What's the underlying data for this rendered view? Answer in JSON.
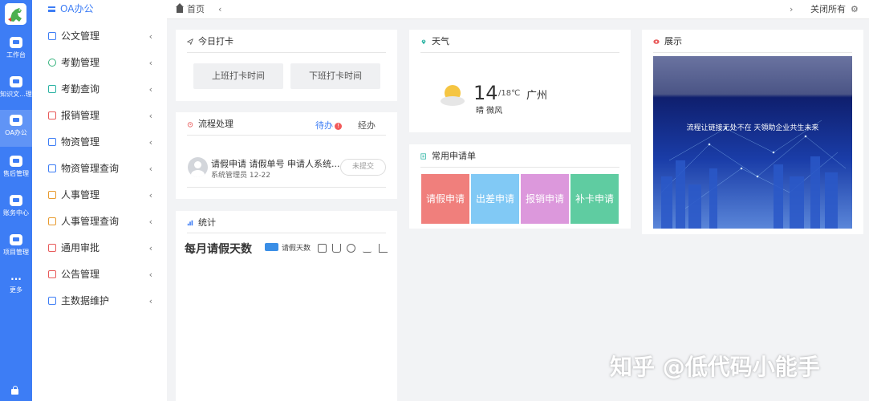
{
  "rail": {
    "items": [
      {
        "label": "工作台",
        "icon": "workbench-icon"
      },
      {
        "label": "知识文...理",
        "icon": "knowledge-icon"
      },
      {
        "label": "OA办公",
        "icon": "oa-icon",
        "active": true
      },
      {
        "label": "售后管理",
        "icon": "after-sales-icon"
      },
      {
        "label": "账务中心",
        "icon": "finance-icon"
      },
      {
        "label": "项目管理",
        "icon": "project-icon"
      },
      {
        "label": "更多",
        "icon": "more-icon"
      }
    ]
  },
  "menu": {
    "header": "OA办公",
    "items": [
      {
        "label": "公文管理",
        "icon": "document-icon"
      },
      {
        "label": "考勤管理",
        "icon": "clock-icon"
      },
      {
        "label": "考勤查询",
        "icon": "user-search-icon"
      },
      {
        "label": "报销管理",
        "icon": "reimbursement-icon"
      },
      {
        "label": "物资管理",
        "icon": "box-icon"
      },
      {
        "label": "物资管理查询",
        "icon": "box-search-icon"
      },
      {
        "label": "人事管理",
        "icon": "people-icon"
      },
      {
        "label": "人事管理查询",
        "icon": "people-search-icon"
      },
      {
        "label": "通用审批",
        "icon": "approval-icon"
      },
      {
        "label": "公告管理",
        "icon": "megaphone-icon"
      },
      {
        "label": "主数据维护",
        "icon": "sliders-icon"
      }
    ]
  },
  "topbar": {
    "home_label": "首页",
    "prev": "‹",
    "next": "›",
    "close_all": "关闭所有",
    "settings_glyph": "⚙"
  },
  "checkin": {
    "title": "今日打卡",
    "start_button": "上班打卡时间",
    "end_button": "下班打卡时间"
  },
  "workflow": {
    "title": "流程处理",
    "tab_pending": "待办",
    "pending_count": "!",
    "tab_done": "经办",
    "item_title": "请假申请    请假单号 申请人系统...",
    "item_sub": "系统管理员 12-22",
    "item_status": "未提交"
  },
  "stats": {
    "title": "统计",
    "chart_title": "每月请假天数",
    "legend": "请假天数"
  },
  "chart_data": {
    "type": "bar",
    "title": "每月请假天数",
    "series": [
      {
        "name": "请假天数",
        "values": []
      }
    ],
    "categories": []
  },
  "weather": {
    "title": "天气",
    "temp": "14",
    "range": "/18℃",
    "city": "广州",
    "condition": "晴 微风"
  },
  "forms": {
    "title": "常用申请单",
    "tiles": [
      {
        "label": "请假申请",
        "color": "#f07f7c"
      },
      {
        "label": "出差申请",
        "color": "#81c9f5"
      },
      {
        "label": "报销申请",
        "color": "#dc98dc"
      },
      {
        "label": "补卡申请",
        "color": "#5fcca1"
      }
    ]
  },
  "showcase": {
    "title": "展示",
    "banner_text": "流程让链接无处不在 天領助企业共生未来"
  },
  "watermark": "知乎 @低代码小能手"
}
